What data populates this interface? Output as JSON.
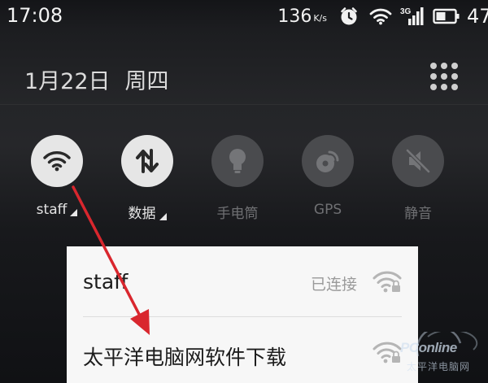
{
  "status_bar": {
    "time": "17:08",
    "net_speed": "136",
    "net_speed_unit": "K/s",
    "network_type": "3G",
    "battery_percent": "47"
  },
  "shade": {
    "date": "1月22日",
    "weekday": "周四"
  },
  "quick_toggles": [
    {
      "label": "staff",
      "state": "on",
      "icon": "wifi-icon"
    },
    {
      "label": "数据",
      "state": "on",
      "icon": "data-transfer-icon"
    },
    {
      "label": "手电筒",
      "state": "off",
      "icon": "flashlight-icon"
    },
    {
      "label": "GPS",
      "state": "off",
      "icon": "gps-icon"
    },
    {
      "label": "静音",
      "state": "off",
      "icon": "mute-icon"
    }
  ],
  "wifi_list": [
    {
      "ssid": "staff",
      "status": "已连接"
    },
    {
      "ssid": "太平洋电脑网软件下载",
      "status": ""
    }
  ],
  "watermark": {
    "brand": "PConline",
    "sub": "太平洋电脑网"
  },
  "colors": {
    "annotation_arrow": "#d9272e",
    "toggle_on": "#e6e6e6",
    "toggle_off": "#4a4b4e"
  }
}
